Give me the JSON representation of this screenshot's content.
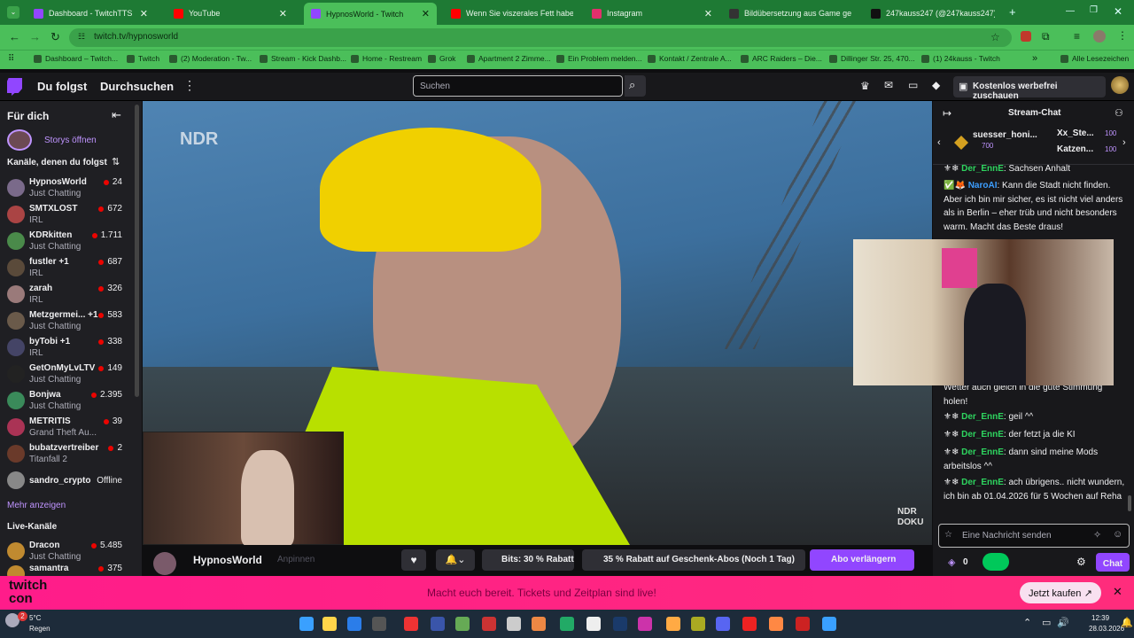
{
  "browser": {
    "tabs": [
      {
        "label": "Dashboard - TwitchTTS",
        "color": "#9146ff"
      },
      {
        "label": "YouTube",
        "color": "#ff0000"
      },
      {
        "label": "HypnosWorld - Twitch",
        "color": "#9146ff"
      },
      {
        "label": "Wenn Sie viszerales Fett haben",
        "color": "#ff0000"
      },
      {
        "label": "Instagram",
        "color": "#e1306c"
      },
      {
        "label": "Bildübersetzung aus Game ge",
        "color": "#333333"
      },
      {
        "label": "247kauss247 (@247kauss247) |",
        "color": "#111111"
      }
    ],
    "url": "twitch.tv/hypnosworld",
    "bookmarks": [
      "Dashboard – Twitch...",
      "Twitch",
      "(2) Moderation - Tw...",
      "Stream - Kick Dashb...",
      "Home - Restream",
      "Grok",
      "Apartment 2 Zimme...",
      "Ein Problem melden...",
      "Kontakt / Zentrale A...",
      "ARC Raiders – Die...",
      "Dillinger Str. 25, 470...",
      "(1) 24kauss - Twitch",
      "Alle Lesezeichen"
    ]
  },
  "twitch": {
    "nav_following": "Du folgst",
    "nav_browse": "Durchsuchen",
    "search_placeholder": "Suchen",
    "adfree": "Kostenlos werbefrei zuschauen"
  },
  "sidebar": {
    "title": "Für dich",
    "stories": "Storys öffnen",
    "followed_header": "Kanäle, denen du folgst",
    "channels": [
      {
        "name": "HypnosWorld",
        "game": "Just Chatting",
        "viewers": "24"
      },
      {
        "name": "SMTXLOST",
        "game": "IRL",
        "viewers": "672"
      },
      {
        "name": "KDRkitten",
        "game": "Just Chatting",
        "viewers": "1.711"
      },
      {
        "name": "fustler +1",
        "game": "IRL",
        "viewers": "687"
      },
      {
        "name": "zarah",
        "game": "IRL",
        "viewers": "326"
      },
      {
        "name": "Metzgermei... +1",
        "game": "Just Chatting",
        "viewers": "583"
      },
      {
        "name": "byTobi +1",
        "game": "IRL",
        "viewers": "338"
      },
      {
        "name": "GetOnMyLvLTV",
        "game": "Just Chatting",
        "viewers": "149"
      },
      {
        "name": "Bonjwa",
        "game": "Just Chatting",
        "viewers": "2.395"
      },
      {
        "name": "METRITIS",
        "game": "Grand Theft Au...",
        "viewers": "39"
      },
      {
        "name": "bubatzvertreiber",
        "game": "Titanfall 2",
        "viewers": "2"
      },
      {
        "name": "sandro_crypto",
        "game": "",
        "viewers": "Offline"
      }
    ],
    "more": "Mehr anzeigen",
    "live_header": "Live-Kanäle",
    "live": [
      {
        "name": "Dracon",
        "game": "Just Chatting",
        "viewers": "5.485"
      },
      {
        "name": "samantra",
        "game": "",
        "viewers": "375"
      }
    ]
  },
  "player": {
    "ndr_logo": "NDR",
    "ndr_doku": "NDR DOKU",
    "channel": "HypnosWorld",
    "pin": "Anpinnen",
    "bits": "Bits: 30 % Rabatt",
    "gift": "35 % Rabatt auf Geschenk-Abos (Noch 1 Tag)",
    "sub": "Abo verlängern"
  },
  "chat": {
    "title": "Stream-Chat",
    "top": [
      {
        "name": "suesser_honi...",
        "amount": "700"
      },
      {
        "name": "Xx_Ste...",
        "amount": "100"
      },
      {
        "name": "Katzen...",
        "amount": "100"
      }
    ],
    "messages": [
      {
        "user": "Der_EnnE",
        "text": "Sachsen Anhalt"
      },
      {
        "user": "NaroAI",
        "text": "Kann die Stadt nicht finden. Aber ich bin mir sicher, es ist nicht viel anders als in Berlin – eher trüb und nicht besonders warm. Macht das Beste draus!"
      },
      {
        "user": "",
        "text": "Wetter auch gleich in die gute Stimmung holen!"
      },
      {
        "user": "Der_EnnE",
        "text": "geil ^^"
      },
      {
        "user": "Der_EnnE",
        "text": "der fetzt ja die KI"
      },
      {
        "user": "Der_EnnE",
        "text": "dann sind meine Mods arbeitslos ^^"
      },
      {
        "user": "Der_EnnE",
        "text": "ach übrigens.. nicht wundern, ich bin ab 01.04.2026 für 5 Wochen auf Reha"
      }
    ],
    "input_placeholder": "Eine Nachricht senden",
    "points": "0",
    "send": "Chat"
  },
  "banner": {
    "logo_top": "twitch",
    "logo_bottom": "con",
    "text": "Macht euch bereit. Tickets und Zeitplan sind live!",
    "button": "Jetzt kaufen"
  },
  "taskbar": {
    "weather_temp": "5°C",
    "weather_text": "Regen",
    "badge": "2",
    "time": "12:39",
    "date": "28.03.2026"
  }
}
